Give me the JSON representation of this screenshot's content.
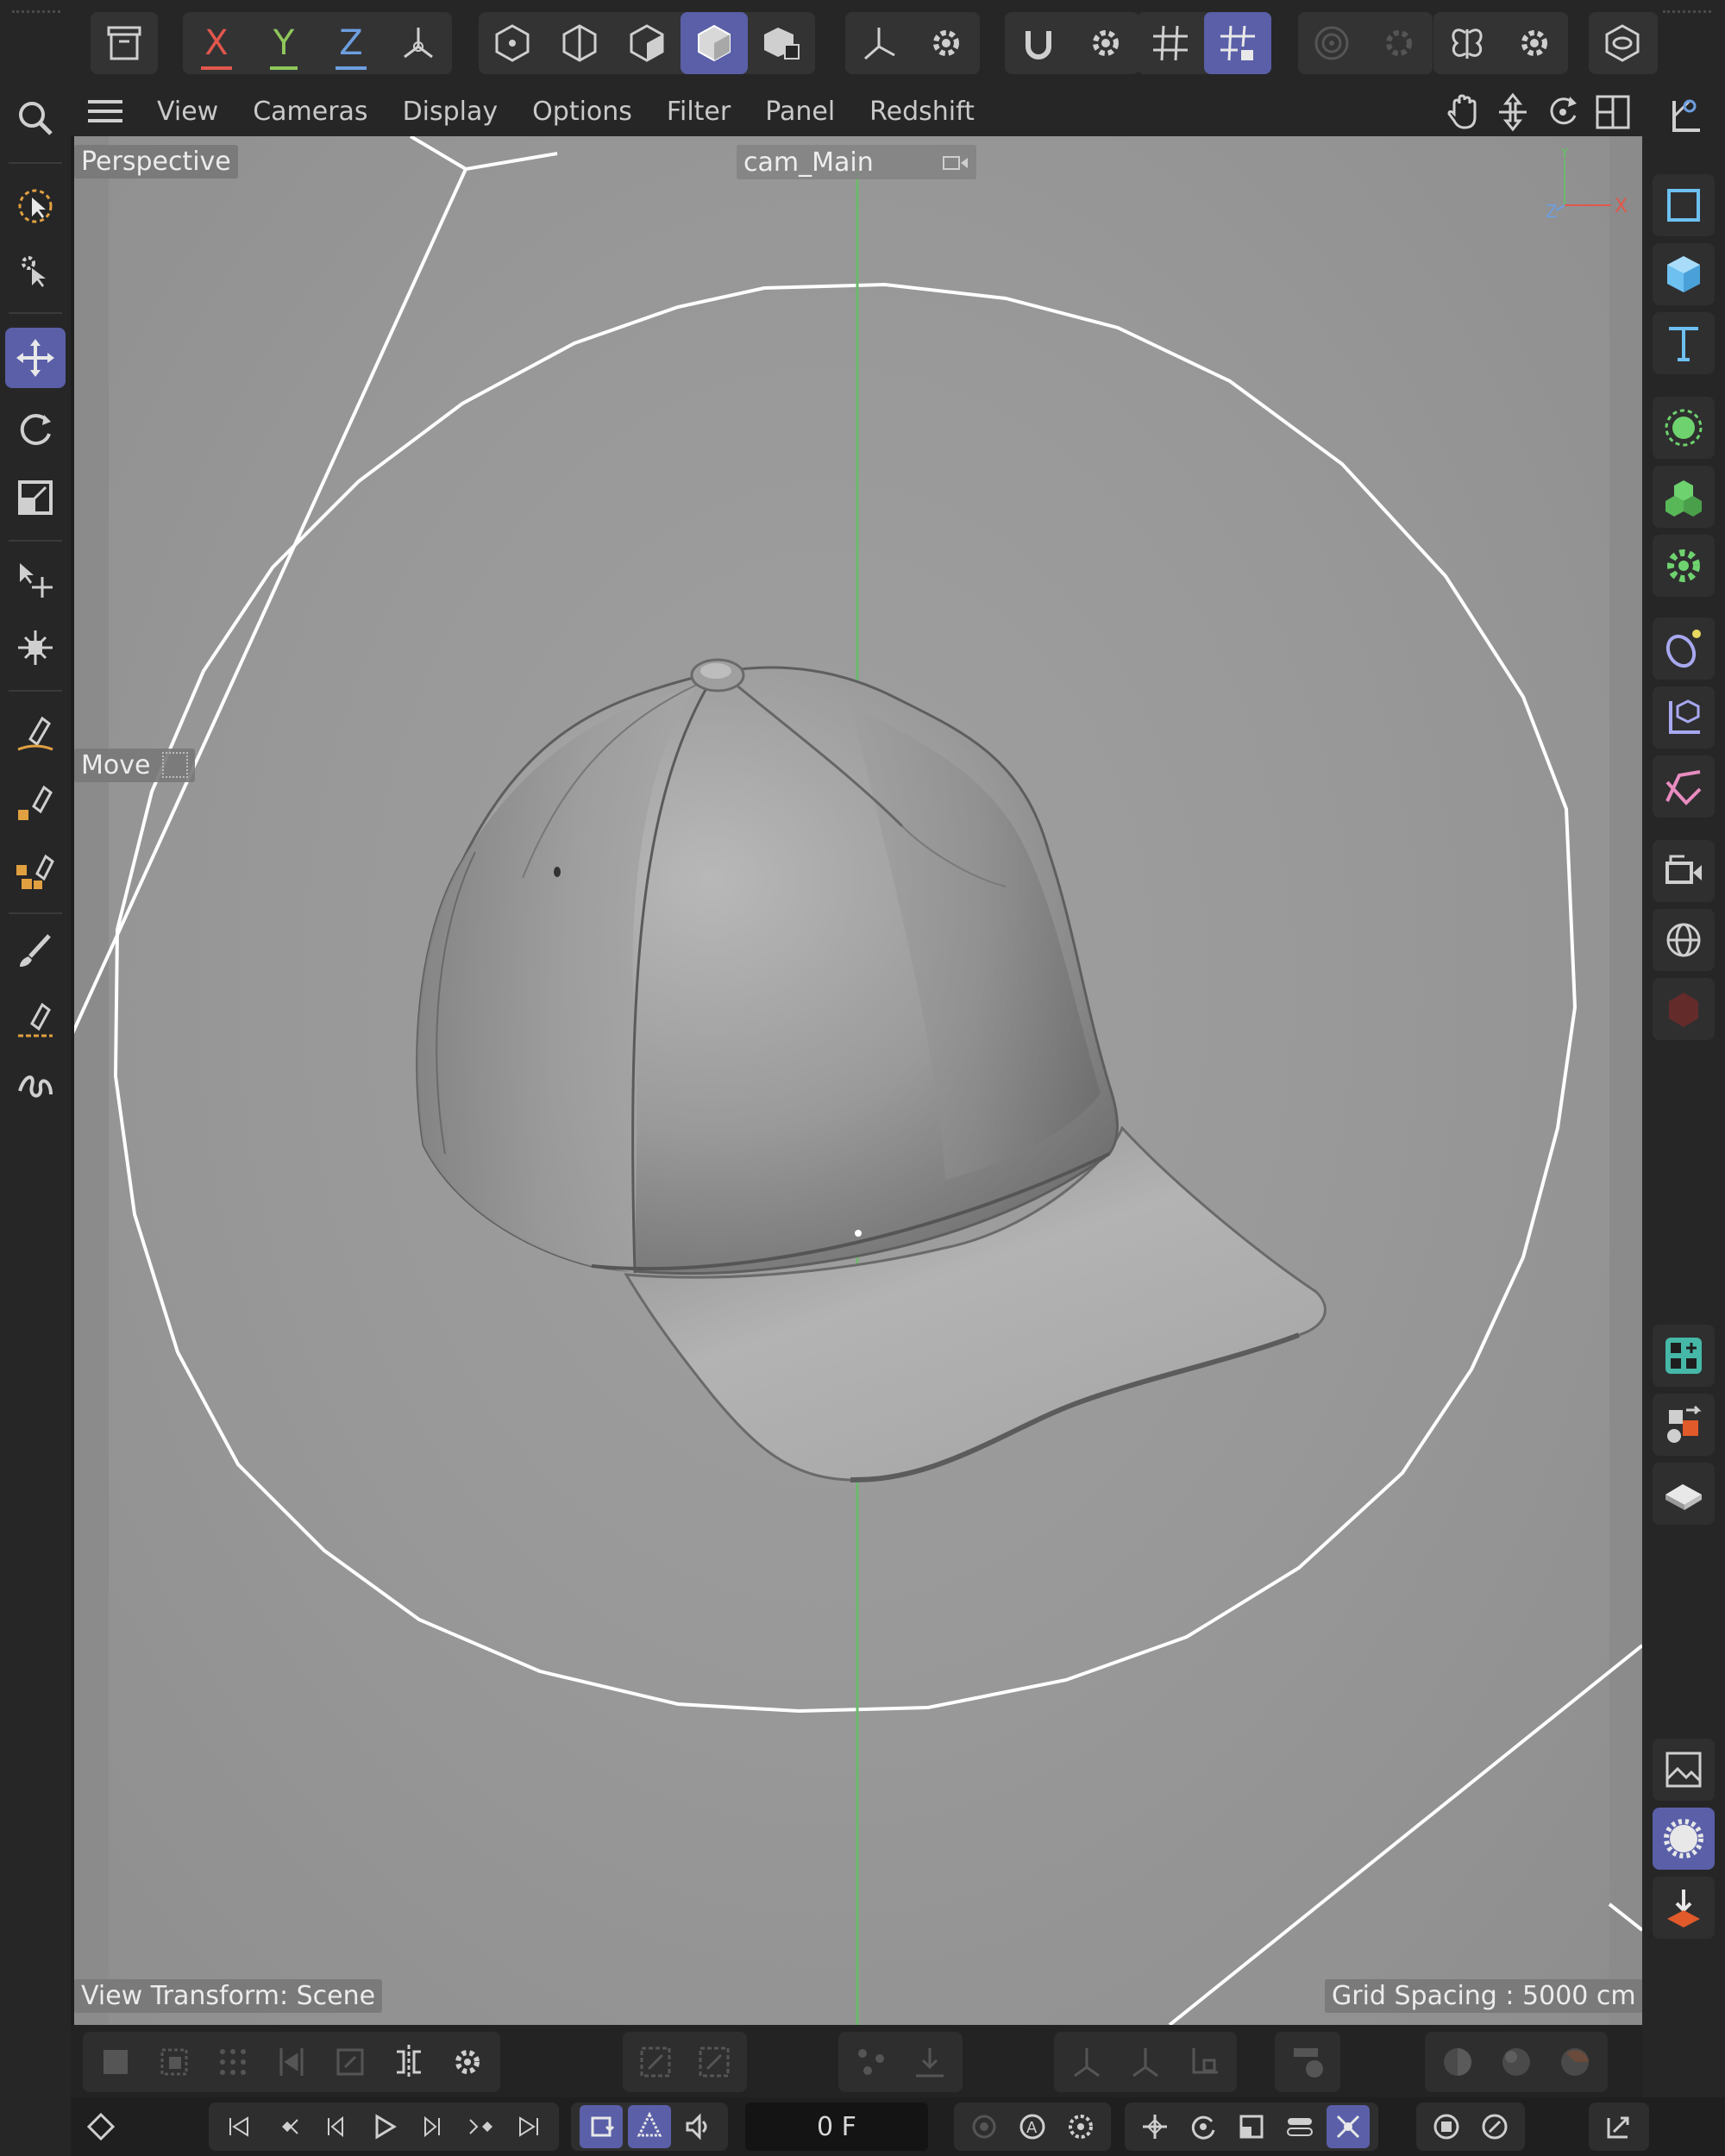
{
  "menubar": {
    "items": [
      "View",
      "Cameras",
      "Display",
      "Options",
      "Filter",
      "Panel",
      "Redshift"
    ]
  },
  "viewport": {
    "view_name": "Perspective",
    "camera": "cam_Main",
    "tool_hud": "Move",
    "view_transform": "View Transform: Scene",
    "grid_spacing": "Grid Spacing : 5000 cm",
    "axis_labels": {
      "x": "X",
      "y": "Y",
      "z": "Z"
    }
  },
  "top_toolbar": {
    "axis_x": "X",
    "axis_y": "Y",
    "axis_z": "Z"
  },
  "timeline": {
    "current_frame": "0 F"
  },
  "colors": {
    "accent_active": "#5a5fa8",
    "axis_x": "#e2574c",
    "axis_y": "#8fc75a",
    "axis_z": "#6d9ee0",
    "viewport_bg": "#9a9a9a"
  }
}
